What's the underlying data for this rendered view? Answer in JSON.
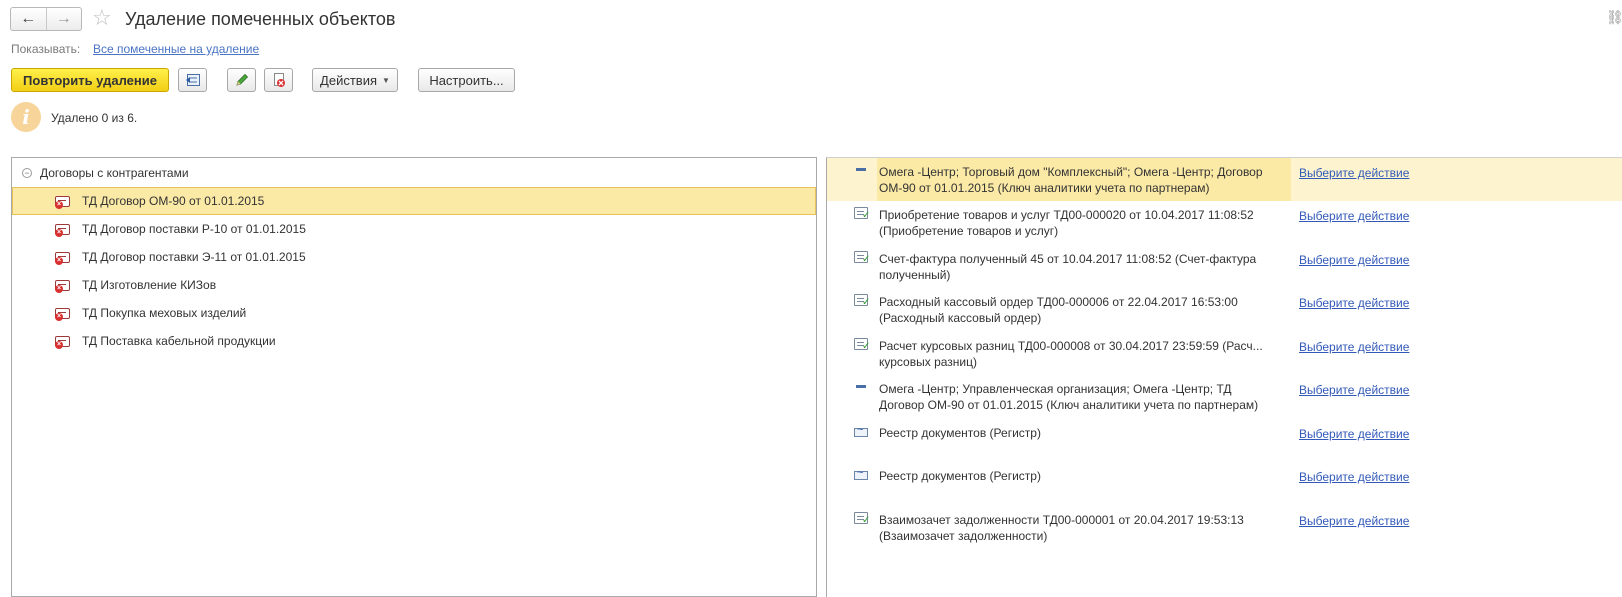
{
  "header": {
    "title": "Удаление помеченных объектов",
    "back_icon": "←",
    "forward_icon": "→",
    "star_icon": "☆",
    "link_icon": "⛓"
  },
  "filter": {
    "label": "Показывать:",
    "link": "Все помеченные на удаление"
  },
  "toolbar": {
    "repeat_label": "Повторить удаление",
    "actions_label": "Действия",
    "settings_label": "Настроить..."
  },
  "info": {
    "icon": "i",
    "text": "Удалено 0 из 6."
  },
  "tree": {
    "root_toggle": "−",
    "root_label": "Договоры с контрагентами",
    "items": [
      {
        "label": "ТД Договор ОМ-90 от 01.01.2015"
      },
      {
        "label": "ТД Договор поставки Р-10 от 01.01.2015"
      },
      {
        "label": "ТД Договор поставки Э-11 от 01.01.2015"
      },
      {
        "label": "ТД Изготовление КИЗов"
      },
      {
        "label": "ТД Покупка меховых изделий"
      },
      {
        "label": "ТД Поставка кабельной продукции"
      }
    ]
  },
  "links": {
    "items": [
      {
        "icon": "minus-icon",
        "line1": "Омега -Центр; Торговый дом \"Комплексный\"; Омега -Центр; Договор",
        "line2": "ОМ-90 от 01.01.2015 (Ключ аналитики учета по партнерам)",
        "action": "Выберите действие"
      },
      {
        "icon": "document-icon",
        "line1": "Приобретение товаров и услуг ТД00-000020 от 10.04.2017 11:08:52",
        "line2": "(Приобретение товаров и услуг)",
        "action": "Выберите действие"
      },
      {
        "icon": "document-icon",
        "line1": "Счет-фактура полученный 45 от 10.04.2017 11:08:52 (Счет-фактура",
        "line2": "полученный)",
        "action": "Выберите действие"
      },
      {
        "icon": "document-icon",
        "line1": "Расходный кассовый ордер ТД00-000006 от 22.04.2017 16:53:00",
        "line2": "(Расходный кассовый ордер)",
        "action": "Выберите действие"
      },
      {
        "icon": "document-icon",
        "line1": "Расчет курсовых разниц ТД00-000008 от 30.04.2017 23:59:59 (Расч...",
        "line2": "курсовых разниц)",
        "action": "Выберите действие"
      },
      {
        "icon": "minus-icon",
        "line1": "Омега -Центр; Управленческая организация; Омега -Центр; ТД",
        "line2": "Договор ОМ-90 от 01.01.2015 (Ключ аналитики учета по партнерам)",
        "action": "Выберите действие"
      },
      {
        "icon": "register-icon",
        "line1": "Реестр документов (Регистр)",
        "line2": "",
        "action": "Выберите действие"
      },
      {
        "icon": "register-icon",
        "line1": "Реестр документов (Регистр)",
        "line2": "",
        "action": "Выберите действие"
      },
      {
        "icon": "document-icon",
        "line1": "Взаимозачет задолженности ТД00-000001 от 20.04.2017 19:53:13",
        "line2": "(Взаимозачет задолженности)",
        "action": "Выберите действие"
      }
    ]
  }
}
